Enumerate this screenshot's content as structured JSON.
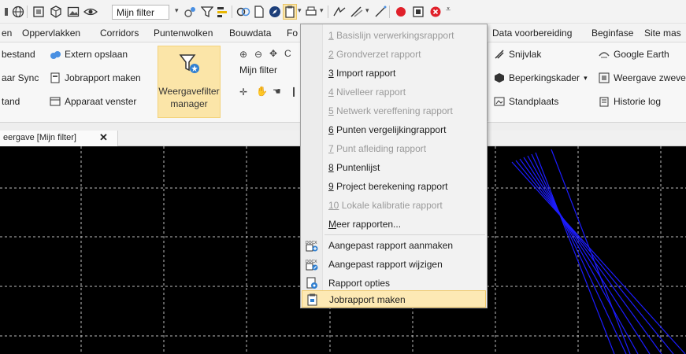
{
  "qat": {
    "filter_value": "Mijn filter",
    "icons": [
      "globe-icon",
      "select-icon",
      "cube-icon",
      "image-icon",
      "eye-icon",
      "views-icon",
      "filter-icon",
      "layers-icon",
      "group-icon",
      "document-icon",
      "compass-icon",
      "report-icon",
      "printer-icon",
      "measure-icon",
      "brush-icon",
      "line-icon",
      "record-icon",
      "stop-icon",
      "close-icon",
      "qat-menu-icon"
    ]
  },
  "tabs": [
    "en",
    "Oppervlakken",
    "Corridors",
    "Puntenwolken",
    "Bouwdata",
    "Fo",
    "Data voorbereiding",
    "Beginfase",
    "Site mas"
  ],
  "ribbon": {
    "col1": [
      "bestand",
      "aar Sync",
      "tand"
    ],
    "col2": [
      "Extern opslaan",
      "Jobrapport maken",
      "Apparaat venster"
    ],
    "big_button_line1": "Weergavefilter",
    "big_button_line2": "manager",
    "filter_label": "Mijn filter",
    "right_col1": [
      "Snijvlak",
      "Beperkingskader",
      "Standplaats"
    ],
    "right_col2": [
      "Google Earth",
      "Weergave zweve",
      "Historie log"
    ]
  },
  "doc_tab": {
    "label": "eergave [Mijn filter]",
    "close": "✕"
  },
  "menu": {
    "items": [
      {
        "num": "1",
        "text": " Basislijn verwerkingsrapport",
        "disabled": true
      },
      {
        "num": "2",
        "text": " Grondverzet rapport",
        "disabled": true
      },
      {
        "num": "3",
        "text": " Import rapport",
        "disabled": false
      },
      {
        "num": "4",
        "text": " Nivelleer rapport",
        "disabled": true
      },
      {
        "num": "5",
        "text": " Netwerk vereffening rapport",
        "disabled": true
      },
      {
        "num": "6",
        "text": " Punten vergelijkingrapport",
        "disabled": false
      },
      {
        "num": "7",
        "text": " Punt afleiding rapport",
        "disabled": true
      },
      {
        "num": "8",
        "text": " Puntenlijst",
        "disabled": false
      },
      {
        "num": "9",
        "text": " Project berekening rapport",
        "disabled": false
      },
      {
        "num": "10",
        "text": " Lokale kalibratie rapport",
        "disabled": true
      },
      {
        "num": "M",
        "text": "eer rapporten...",
        "disabled": false
      }
    ],
    "actions": [
      {
        "text": "Aangepast rapport aanmaken",
        "icon": "docx-add-icon"
      },
      {
        "text": "Aangepast rapport wijzigen",
        "icon": "docx-edit-icon"
      },
      {
        "text": "Rapport opties",
        "icon": "report-options-icon"
      },
      {
        "text": "Jobrapport maken",
        "icon": "job-report-icon"
      }
    ]
  },
  "colors": {
    "accent_highlight": "#fde9b4",
    "ribbon_selected": "#fbe5a8",
    "viewport_bg": "#000000",
    "linework": "#1c1cff",
    "grid": "#bdbdbd",
    "record_red": "#e0202a"
  }
}
